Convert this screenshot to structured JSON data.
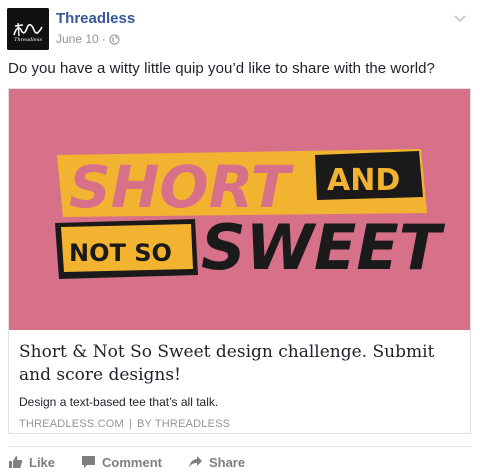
{
  "post": {
    "page_name": "Threadless",
    "avatar_text": "Threadless",
    "date": "June 10",
    "meta_separator": "·",
    "message": "Do you have a witty little quip you’d like to share with the world?",
    "privacy_icon": "globe-icon",
    "menu_icon": "chevron-down-icon"
  },
  "link_card": {
    "image_text": {
      "line1_a": "SHORT",
      "line1_b": "AND",
      "line2_a": "NOT SO",
      "line2_b": "SWEET"
    },
    "title": "Short & Not So Sweet design challenge. Submit and score designs!",
    "description": "Design a text-based tee that’s all talk.",
    "domain": "THREADLESS.COM",
    "separator": "|",
    "byline": "BY THREADLESS"
  },
  "actions": [
    {
      "label": "Like",
      "icon": "thumbs-up-icon"
    },
    {
      "label": "Comment",
      "icon": "comment-icon"
    },
    {
      "label": "Share",
      "icon": "share-icon"
    }
  ],
  "colors": {
    "link_blue": "#365899",
    "image_pink": "#d7718a",
    "image_yellow": "#f2b430",
    "image_dark": "#1a1a1a",
    "muted": "#90949c"
  }
}
